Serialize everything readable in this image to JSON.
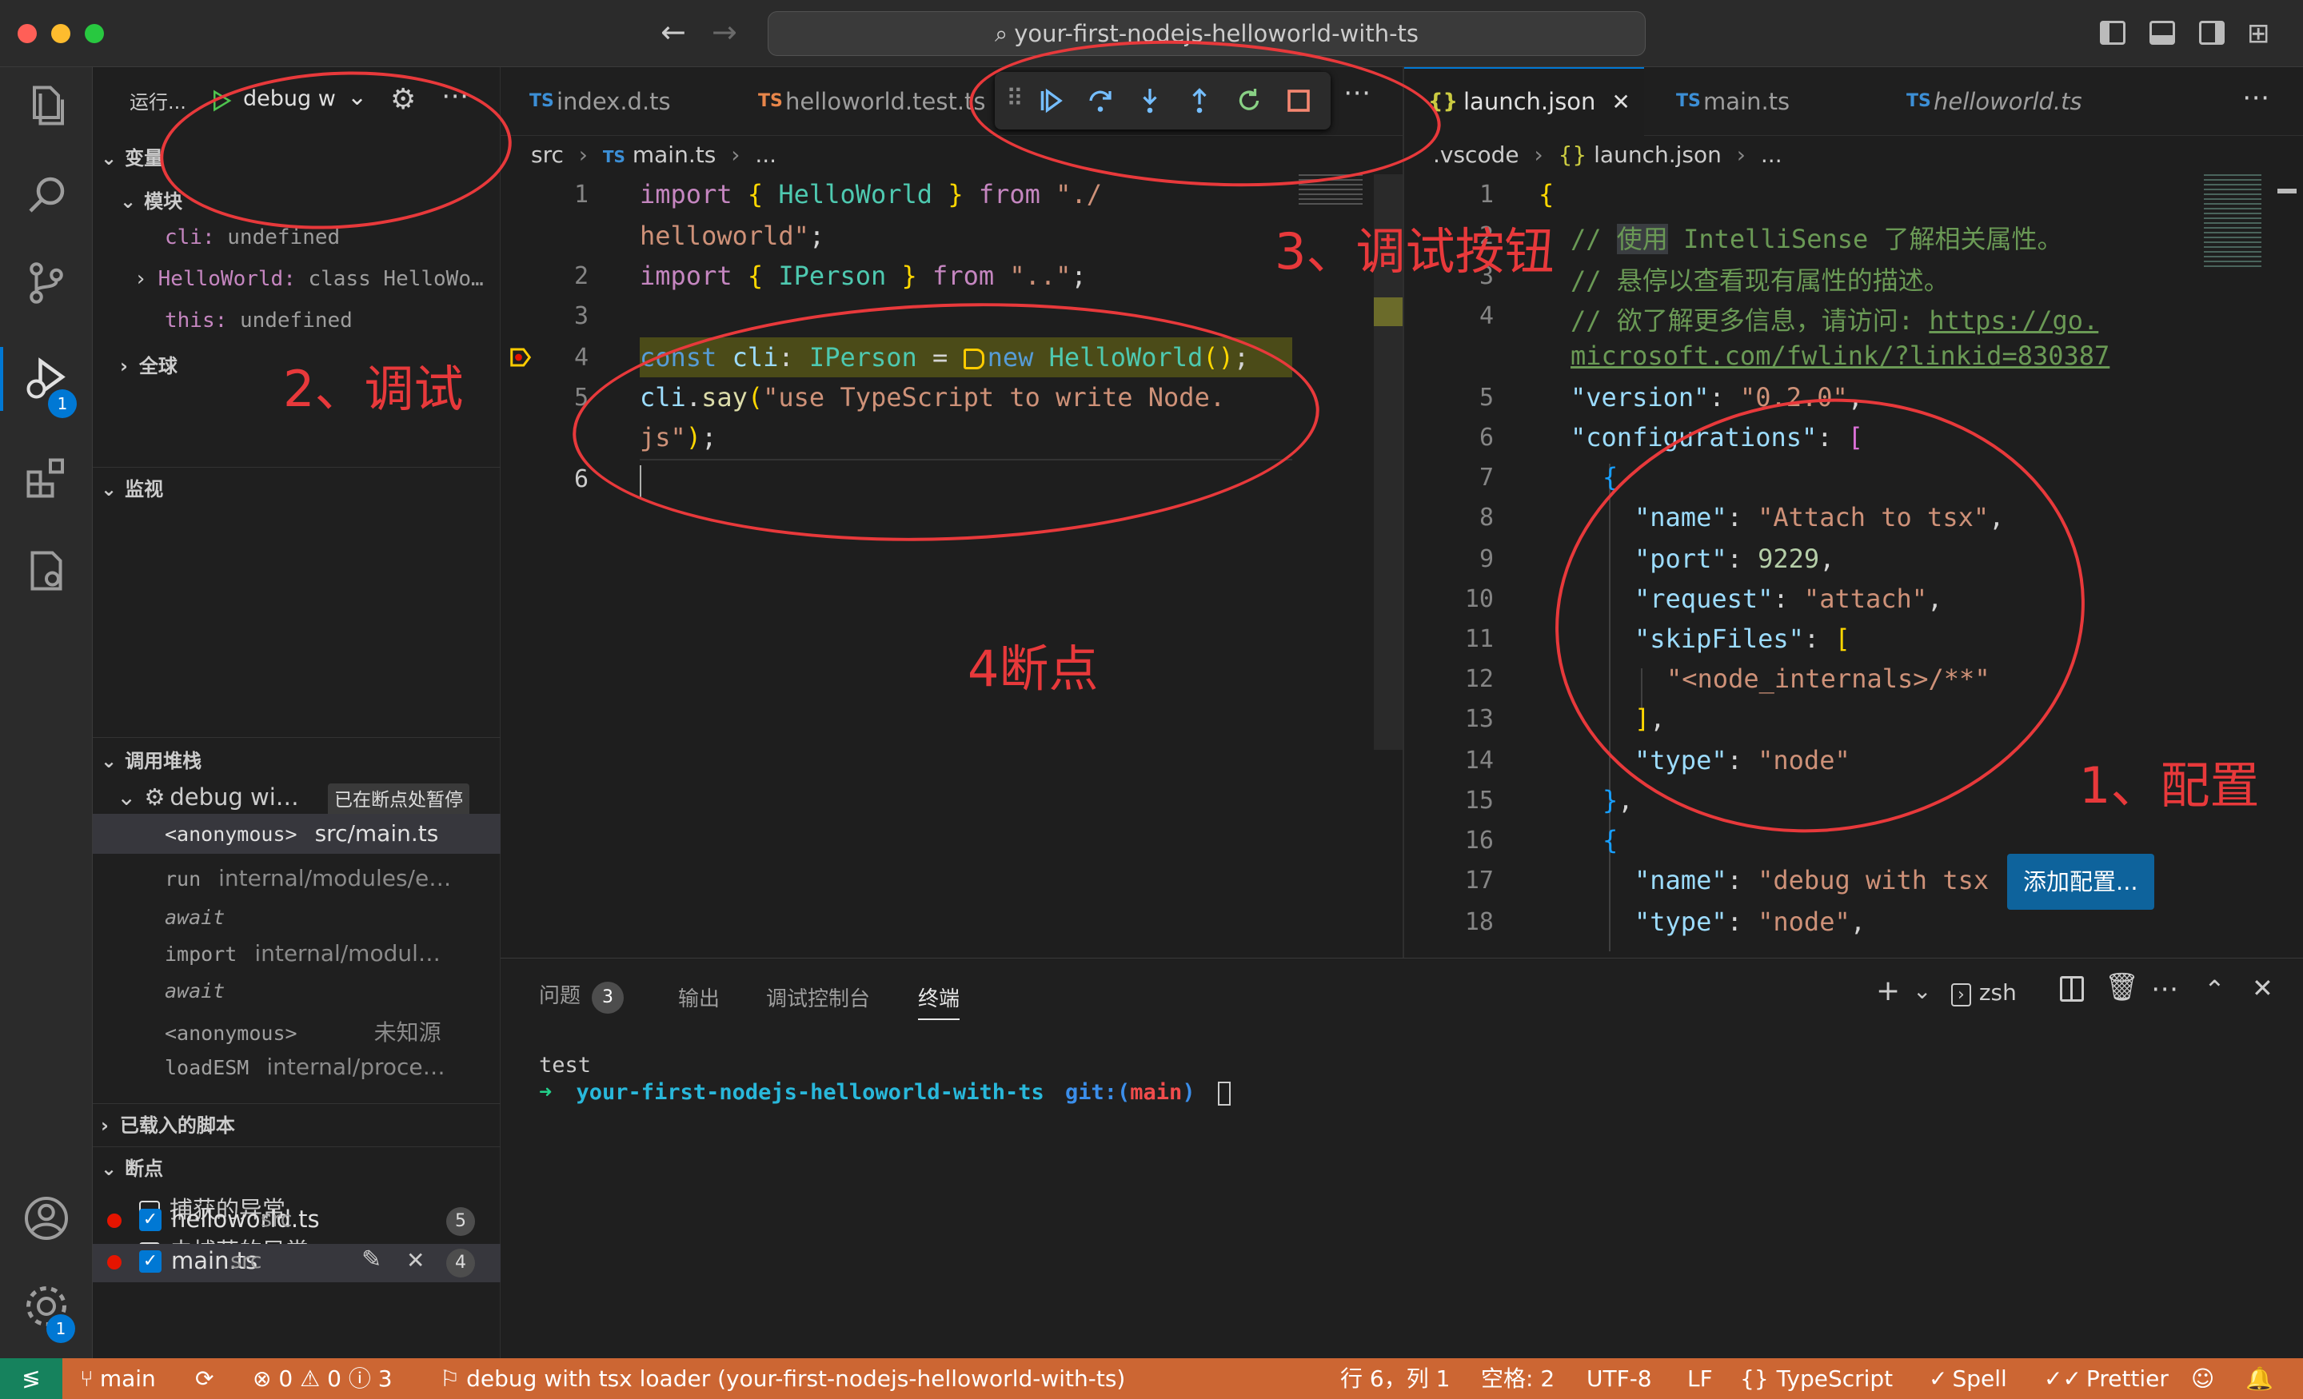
{
  "titlebar": {
    "search_text": "your-first-nodejs-helloworld-with-ts"
  },
  "activity": {
    "debug_badge": "1",
    "settings_badge": "1"
  },
  "sidebar": {
    "run_label": "运行...",
    "config_name": "debug w",
    "variables": {
      "header": "变量",
      "module_header": "模块",
      "cli_name": "cli:",
      "cli_value": "undefined",
      "helloworld_name": "HelloWorld:",
      "helloworld_value": "class HelloWo…",
      "this_name": "this:",
      "this_value": "undefined",
      "global_header": "全球"
    },
    "watch_header": "监视",
    "callstack": {
      "header": "调用堆栈",
      "session": "debug wi…",
      "paused": "已在断点处暂停",
      "frames": [
        {
          "name": "<anonymous>",
          "src": "src/main.ts"
        },
        {
          "name": "run",
          "src": "internal/modules/e…"
        },
        {
          "name": "await",
          "src": ""
        },
        {
          "name": "import",
          "src": "internal/modul…"
        },
        {
          "name": "await",
          "src": ""
        },
        {
          "name": "<anonymous>",
          "src": "未知源"
        },
        {
          "name": "loadESM",
          "src": "internal/proce…"
        }
      ]
    },
    "loaded_scripts": "已载入的脚本",
    "breakpoints": {
      "header": "断点",
      "caught": "捕获的异常",
      "uncaught": "未捕获的异常",
      "items": [
        {
          "file": "helloworld.ts",
          "dir": "src",
          "line": "5"
        },
        {
          "file": "main.ts",
          "dir": "src",
          "line": "4"
        }
      ]
    }
  },
  "left_editor": {
    "tabs": [
      "index.d.ts",
      "helloworld.test.ts"
    ],
    "crumbs": {
      "a": "src",
      "b": "main.ts",
      "c": "..."
    },
    "line_numbers": [
      "1",
      "2",
      "3",
      "4",
      "5",
      "6"
    ],
    "lines": {
      "l1a": "import ",
      "l1b": "{ ",
      "l1c": "HelloWorld",
      "l1d": " }",
      "l1e": " from ",
      "l1f": "\"./",
      "l1g": "helloworld\"",
      "l1h": ";",
      "l2a": "import ",
      "l2b": "{ ",
      "l2c": "IPerson",
      "l2d": " }",
      "l2e": " from ",
      "l2f": "\"..\"",
      "l2g": ";",
      "l4a": "const ",
      "l4b": "cli",
      "l4c": ": ",
      "l4d": "IPerson",
      "l4e": " = ",
      "l4f": "new ",
      "l4g": "HelloWorld",
      "l4h": "()",
      "l4i": ";",
      "l5a": "cli",
      "l5b": ".",
      "l5c": "say",
      "l5d": "(",
      "l5e": "\"use TypeScript to write Node.",
      "l5f": "js\"",
      "l5g": ")",
      "l5h": ";"
    }
  },
  "right_editor": {
    "tabs": [
      "launch.json",
      "main.ts",
      "helloworld.ts"
    ],
    "crumbs": {
      "a": ".vscode",
      "b": "launch.json",
      "c": "..."
    },
    "line_numbers": [
      "1",
      "2",
      "3",
      "4",
      "",
      "5",
      "6",
      "7",
      "8",
      "9",
      "10",
      "11",
      "12",
      "13",
      "14",
      "15",
      "16",
      "17",
      "18"
    ],
    "lines": {
      "l1": "{",
      "l2a": "// ",
      "l2b": "使用",
      "l2c": " IntelliSense 了解相关属性。",
      "l3": "// 悬停以查看现有属性的描述。",
      "l4a": "// 欲了解更多信息，请访问: ",
      "l4b": "https://go.",
      "l4c": "microsoft.com/fwlink/?linkid=830387",
      "l5a": "\"version\"",
      "l5b": ": ",
      "l5c": "\"0.2.0\"",
      "l5d": ",",
      "l6a": "\"configurations\"",
      "l6b": ": ",
      "l6c": "[",
      "l7": "{",
      "l8a": "\"name\"",
      "l8b": ": ",
      "l8c": "\"Attach to tsx\"",
      "l8d": ",",
      "l9a": "\"port\"",
      "l9b": ": ",
      "l9c": "9229",
      "l9d": ",",
      "l10a": "\"request\"",
      "l10b": ": ",
      "l10c": "\"attach\"",
      "l10d": ",",
      "l11a": "\"skipFiles\"",
      "l11b": ": ",
      "l11c": "[",
      "l12": "\"<node_internals>/**\"",
      "l13a": "]",
      "l13b": ",",
      "l14a": "\"type\"",
      "l14b": ": ",
      "l14c": "\"node\"",
      "l15a": "}",
      "l15b": ",",
      "l16": "{",
      "l17a": "\"name\"",
      "l17b": ": ",
      "l17c": "\"debug with tsx",
      "l18a": "\"type\"",
      "l18b": ": ",
      "l18c": "\"node\"",
      "l18d": ","
    },
    "add_config_button": "添加配置..."
  },
  "panel": {
    "tabs": {
      "problems": "问题",
      "problems_count": "3",
      "output": "输出",
      "debug_console": "调试控制台",
      "terminal": "终端"
    },
    "shell": "zsh",
    "terminal": {
      "line1": "test",
      "prompt_arrow": "➜",
      "prompt_dir": "your-first-nodejs-helloworld-with-ts",
      "prompt_git": "git:(",
      "prompt_branch": "main",
      "prompt_end": ")"
    }
  },
  "statusbar": {
    "branch": "main",
    "errors": "0",
    "warnings": "0",
    "infos": "3",
    "debug": "debug with tsx loader (your-first-nodejs-helloworld-with-ts)",
    "position": "行 6，列 1",
    "spaces": "空格: 2",
    "encoding": "UTF-8",
    "eol": "LF",
    "language": "TypeScript",
    "spell": "Spell",
    "prettier": "Prettier"
  },
  "annotations": {
    "config": "1、配置",
    "debug": "2、调试",
    "buttons": "3、调试按钮",
    "breakpoint": "4断点"
  },
  "colors": {
    "statusbar": "#cc6633",
    "accent": "#0078d4",
    "annotation": "#e8393b",
    "breakpoint": "#e51400"
  }
}
